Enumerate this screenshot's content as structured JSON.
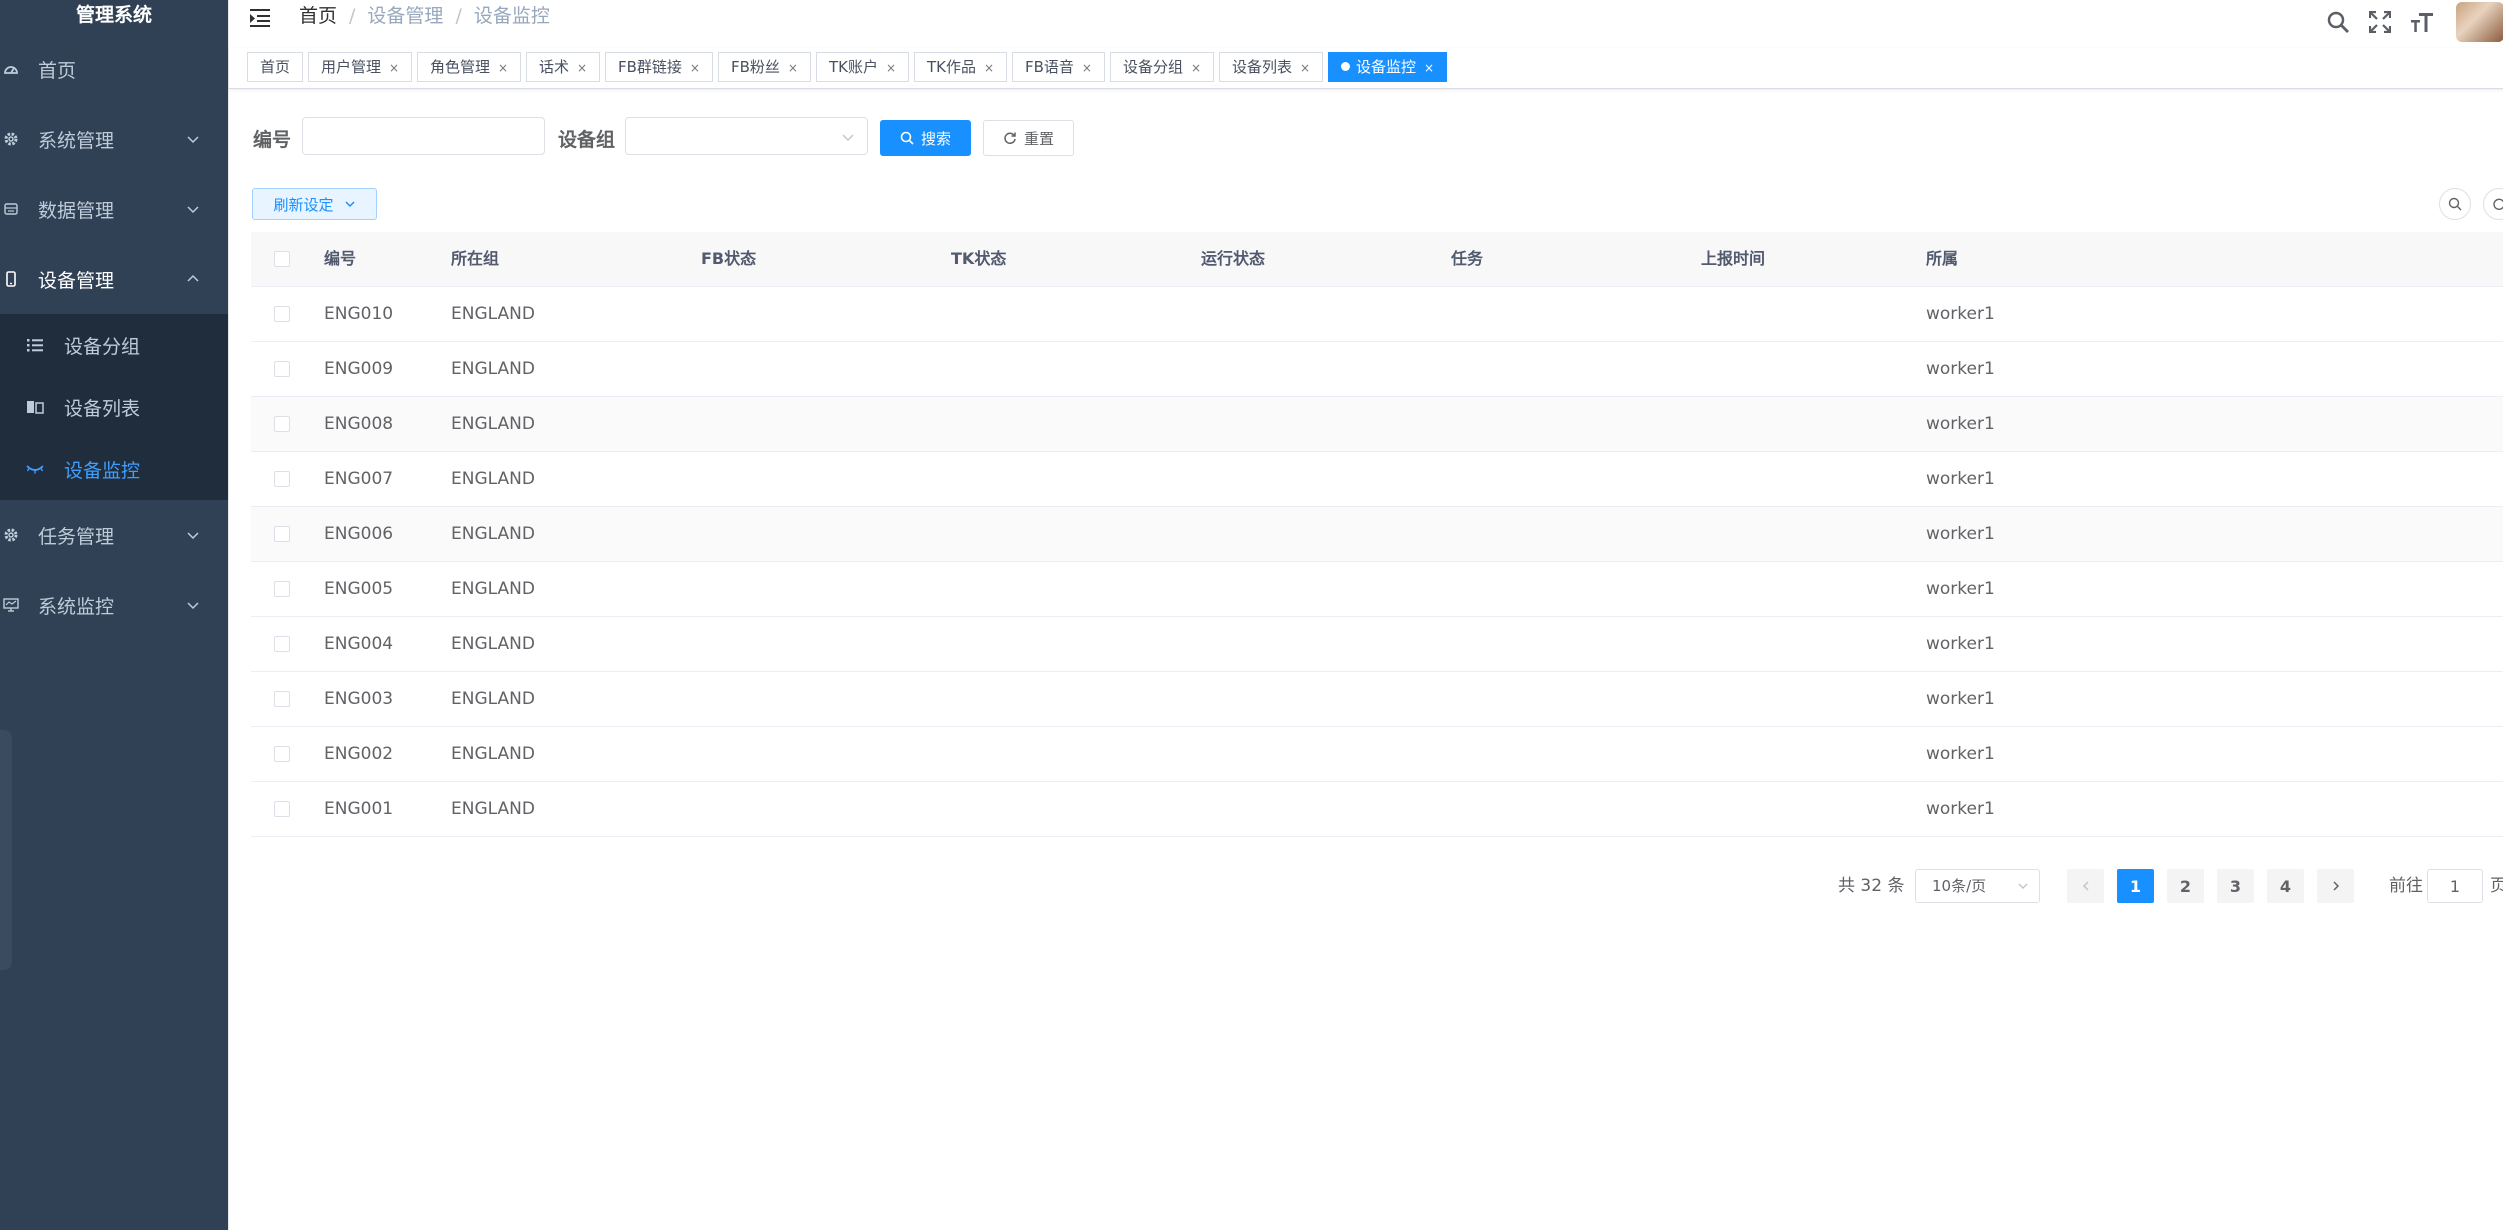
{
  "app": {
    "title": "管理系统"
  },
  "sidebar": {
    "items": [
      {
        "label": "首页",
        "icon": "dashboard-icon"
      },
      {
        "label": "系统管理",
        "icon": "gear-icon"
      },
      {
        "label": "数据管理",
        "icon": "database-icon"
      },
      {
        "label": "设备管理",
        "icon": "phone-icon",
        "expanded": true
      },
      {
        "label": "任务管理",
        "icon": "gear-icon"
      },
      {
        "label": "系统监控",
        "icon": "monitor-icon"
      }
    ],
    "subitems": [
      {
        "label": "设备分组",
        "icon": "list-icon"
      },
      {
        "label": "设备列表",
        "icon": "table-icon"
      },
      {
        "label": "设备监控",
        "icon": "eye-icon",
        "active": true
      }
    ]
  },
  "breadcrumb": {
    "home": "首页",
    "level1": "设备管理",
    "level2": "设备监控"
  },
  "tags": [
    {
      "label": "首页"
    },
    {
      "label": "用户管理"
    },
    {
      "label": "角色管理"
    },
    {
      "label": "话术"
    },
    {
      "label": "FB群链接"
    },
    {
      "label": "FB粉丝"
    },
    {
      "label": "TK账户"
    },
    {
      "label": "TK作品"
    },
    {
      "label": "FB语音"
    },
    {
      "label": "设备分组"
    },
    {
      "label": "设备列表"
    },
    {
      "label": "设备监控",
      "active": true
    }
  ],
  "search": {
    "code_label": "编号",
    "code_value": "",
    "group_label": "设备组",
    "group_value": "",
    "search_button": "搜索",
    "reset_button": "重置"
  },
  "toolbar": {
    "refresh_setting": "刷新设定"
  },
  "table": {
    "columns": [
      "编号",
      "所在组",
      "FB状态",
      "TK状态",
      "运行状态",
      "任务",
      "上报时间",
      "所属"
    ],
    "rows": [
      {
        "code": "ENG010",
        "group": "ENGLAND",
        "owner": "worker1"
      },
      {
        "code": "ENG009",
        "group": "ENGLAND",
        "owner": "worker1"
      },
      {
        "code": "ENG008",
        "group": "ENGLAND",
        "owner": "worker1"
      },
      {
        "code": "ENG007",
        "group": "ENGLAND",
        "owner": "worker1"
      },
      {
        "code": "ENG006",
        "group": "ENGLAND",
        "owner": "worker1"
      },
      {
        "code": "ENG005",
        "group": "ENGLAND",
        "owner": "worker1"
      },
      {
        "code": "ENG004",
        "group": "ENGLAND",
        "owner": "worker1"
      },
      {
        "code": "ENG003",
        "group": "ENGLAND",
        "owner": "worker1"
      },
      {
        "code": "ENG002",
        "group": "ENGLAND",
        "owner": "worker1"
      },
      {
        "code": "ENG001",
        "group": "ENGLAND",
        "owner": "worker1"
      }
    ]
  },
  "pagination": {
    "total_text": "共 32 条",
    "page_size": "10条/页",
    "pages": [
      "1",
      "2",
      "3",
      "4"
    ],
    "current_page": "1",
    "goto_label": "前往",
    "goto_value": "1",
    "page_suffix": "页"
  },
  "colors": {
    "sidebar_bg": "#304156",
    "submenu_bg": "#1f2d3d",
    "accent": "#1890ff",
    "active_menu": "#409eff"
  }
}
